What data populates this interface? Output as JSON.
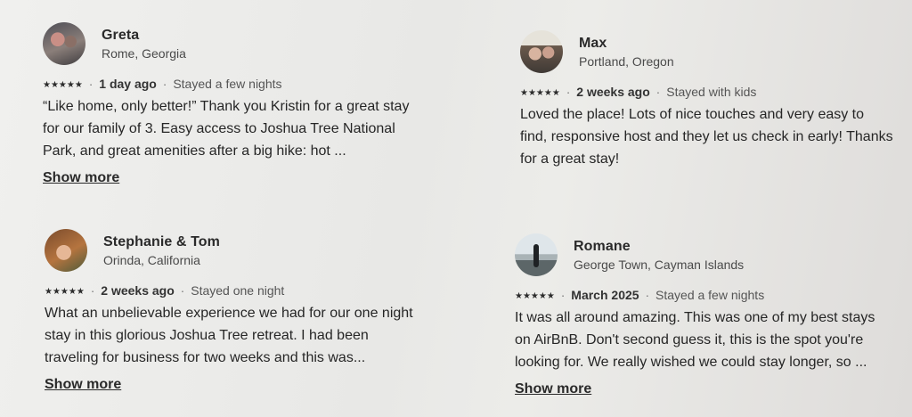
{
  "reviews": [
    {
      "name": "Greta",
      "location": "Rome, Georgia",
      "stars": "★★★★★",
      "when": "1 day ago",
      "stay": "Stayed a few nights",
      "text": "“Like home, only better!” Thank you Kristin for a great stay for our family of 3. Easy access to Joshua Tree National Park, and great amenities after a big hike: hot ...",
      "link": "Show more"
    },
    {
      "name": "Max",
      "location": "Portland, Oregon",
      "stars": "★★★★★",
      "when": "2 weeks ago",
      "stay": "Stayed with kids",
      "text": "Loved the place! Lots of nice touches and very easy to find, responsive host and they let us check in early! Thanks for a great stay!",
      "link": ""
    },
    {
      "name": "Stephanie & Tom",
      "location": "Orinda, California",
      "stars": "★★★★★",
      "when": "2 weeks ago",
      "stay": "Stayed one night",
      "text": "What an unbelievable experience we had for our one night stay in this glorious Joshua Tree retreat.  I had been traveling for business for two weeks and this was...",
      "link": "Show more"
    },
    {
      "name": "Romane",
      "location": "George Town, Cayman Islands",
      "stars": "★★★★★",
      "when": "March 2025",
      "stay": "Stayed a few nights",
      "text": "It was all around amazing. This was one of my best stays on AirBnB. Don't second guess it, this is the spot you're looking for. We really wished we could stay longer, so ...",
      "link": "Show more"
    }
  ],
  "separator": "·"
}
